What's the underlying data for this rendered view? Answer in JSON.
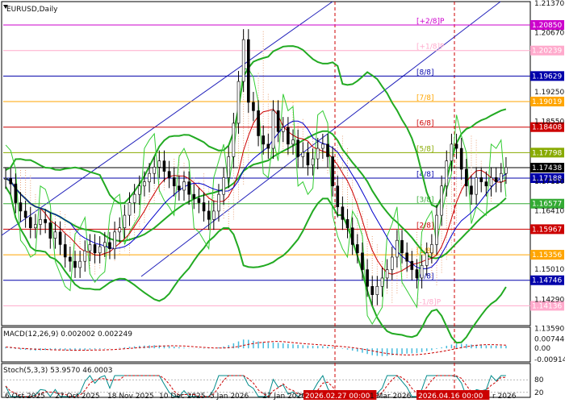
{
  "title": "EURUSD,Daily",
  "colors": {
    "background": "#ffffff",
    "grid": "#000000",
    "price_line": "#000000",
    "bollinger": "#22aa22",
    "envelope_green": "#33cc33",
    "red_ma": "#cc0000",
    "blue_ma": "#0000cc",
    "channel_blue": "#2222bb",
    "ichimoku_cloud": "#e8a37a",
    "macd_hist": "#44bbdd",
    "macd_signal": "#cc0000",
    "stoch_main": "#008b8b",
    "stoch_signal": "#cc0000",
    "vline": "#cc0000"
  },
  "chart_data": [
    {
      "type": "line",
      "panel": "main",
      "title": "EURUSD,Daily",
      "ylim": [
        1.137,
        1.2137
      ],
      "y_ticks": [
        "1.21370",
        "1.20670",
        "1.19250",
        "1.18550",
        "1.17110",
        "1.16410",
        "1.15010",
        "1.14290",
        "1.13590"
      ],
      "x_ticks": [
        "6 Oct 2025",
        "27 Oct 2025",
        "18 Nov 2025",
        "10 Dec 2025",
        "5 Jan 2026",
        "27 Jan 2026",
        "2026.02.27 00:00",
        "1 Mar 2026",
        "2026.04.16 00:00",
        "r 2026"
      ],
      "series": [
        {
          "values": [
            1.1718,
            1.1705,
            1.166,
            1.164,
            1.1625,
            1.16,
            1.1608,
            1.162,
            1.1612,
            1.1575,
            1.159,
            1.156,
            1.153,
            1.152,
            1.1505,
            1.152,
            1.1545,
            1.156,
            1.154,
            1.1555,
            1.1565,
            1.155,
            1.159,
            1.16,
            1.163,
            1.166,
            1.168,
            1.17,
            1.171,
            1.173,
            1.1745,
            1.176,
            1.1735,
            1.172,
            1.17,
            1.169,
            1.171,
            1.168,
            1.167,
            1.166,
            1.164,
            1.162,
            1.164,
            1.168,
            1.172,
            1.177,
            1.185,
            1.195,
            1.205,
            1.19,
            1.188,
            1.182,
            1.18,
            1.179,
            1.188,
            1.183,
            1.184,
            1.18,
            1.181,
            1.177,
            1.178,
            1.175,
            1.1765,
            1.179,
            1.18,
            1.177,
            1.17,
            1.165,
            1.162,
            1.16,
            1.156,
            1.154,
            1.15,
            1.146,
            1.144,
            1.146,
            1.148,
            1.15,
            1.153,
            1.157,
            1.154,
            1.152,
            1.15,
            1.148,
            1.151,
            1.154,
            1.156,
            1.163,
            1.17,
            1.176,
            1.18,
            1.179,
            1.174,
            1.17,
            1.168,
            1.172,
            1.171,
            1.17,
            1.172,
            1.171,
            1.173,
            1.1744
          ]
        }
      ],
      "price_levels": [
        {
          "label": "[+2/8]P",
          "value": 1.2085,
          "color": "#cc00cc",
          "tag": "1.20850"
        },
        {
          "label": "[+1/8]P",
          "value": 1.20239,
          "color": "#ffaacc",
          "tag": "1.20239"
        },
        {
          "label": "[8/8]",
          "value": 1.19629,
          "color": "#0000aa",
          "tag": "1.19629"
        },
        {
          "label": "[7/8]",
          "value": 1.19019,
          "color": "#ffa500",
          "tag": "1.19019"
        },
        {
          "label": "[6/8]",
          "value": 1.18408,
          "color": "#cc0000",
          "tag": "1.18408"
        },
        {
          "label": "[5/8]",
          "value": 1.17798,
          "color": "#88aa00",
          "tag": "1.17798"
        },
        {
          "label": "",
          "value": 1.17438,
          "color": "#000000",
          "tag": "1.17438"
        },
        {
          "label": "[4/8]",
          "value": 1.17188,
          "color": "#0000aa",
          "tag": "1.17188"
        },
        {
          "label": "[3/8]",
          "value": 1.16577,
          "color": "#33aa33",
          "tag": "1.16577"
        },
        {
          "label": "[2/8]",
          "value": 1.15967,
          "color": "#cc0000",
          "tag": "1.15967"
        },
        {
          "label": "[1/8]",
          "value": 1.15356,
          "color": "#ffa500",
          "tag": "1.15356"
        },
        {
          "label": "[0/8]",
          "value": 1.14746,
          "color": "#0000aa",
          "tag": "1.14746"
        },
        {
          "label": "[-1/8]P",
          "value": 1.14136,
          "color": "#ffaacc",
          "tag": "1.14136"
        }
      ]
    },
    {
      "type": "bar",
      "panel": "macd",
      "title": "MACD(12,26,9) 0.002002 0.002249",
      "y_ticks": [
        "0.007446",
        "0.00",
        "-0.009144"
      ],
      "ylim": [
        -0.0095,
        0.0078
      ],
      "series": [
        {
          "values": [
            0.001,
            0.0005,
            -0.0005,
            -0.001,
            -0.0012,
            -0.0015,
            -0.0018,
            -0.0016,
            -0.0014,
            -0.0012,
            -0.001,
            -0.0012,
            -0.0015,
            -0.0017,
            -0.002,
            -0.0018,
            -0.0015,
            -0.001,
            -0.0008,
            -0.0006,
            -0.0004,
            -0.0002,
            0.0,
            0.0004,
            0.0008,
            0.0012,
            0.0016,
            0.002,
            0.0022,
            0.0024,
            0.0025,
            0.0024,
            0.0022,
            0.0018,
            0.0014,
            0.001,
            0.0006,
            0.0002,
            -0.0001,
            -0.0002,
            -0.0003,
            -0.0002,
            0.0001,
            0.0008,
            0.0015,
            0.0025,
            0.004,
            0.0055,
            0.007,
            0.0068,
            0.006,
            0.0055,
            0.005,
            0.0045,
            0.0046,
            0.0044,
            0.004,
            0.0036,
            0.0032,
            0.0028,
            0.0025,
            0.0022,
            0.002,
            0.0019,
            0.0018,
            0.0014,
            0.0008,
            0.0002,
            -0.0004,
            -0.001,
            -0.0018,
            -0.0026,
            -0.0035,
            -0.0045,
            -0.0055,
            -0.006,
            -0.0062,
            -0.006,
            -0.0055,
            -0.0048,
            -0.0045,
            -0.0042,
            -0.004,
            -0.0038,
            -0.003,
            -0.0022,
            -0.0015,
            -0.0005,
            0.0008,
            0.002,
            0.003,
            0.0035,
            0.0036,
            0.0034,
            0.003,
            0.0028,
            0.0026,
            0.0024,
            0.0022,
            0.0021,
            0.002,
            0.002
          ]
        }
      ]
    },
    {
      "type": "line",
      "panel": "stoch",
      "title": "Stoch(5,3,3) 53.9570 46.0003",
      "y_ticks": [
        "80",
        "20"
      ],
      "ylim": [
        0,
        100
      ]
    }
  ]
}
